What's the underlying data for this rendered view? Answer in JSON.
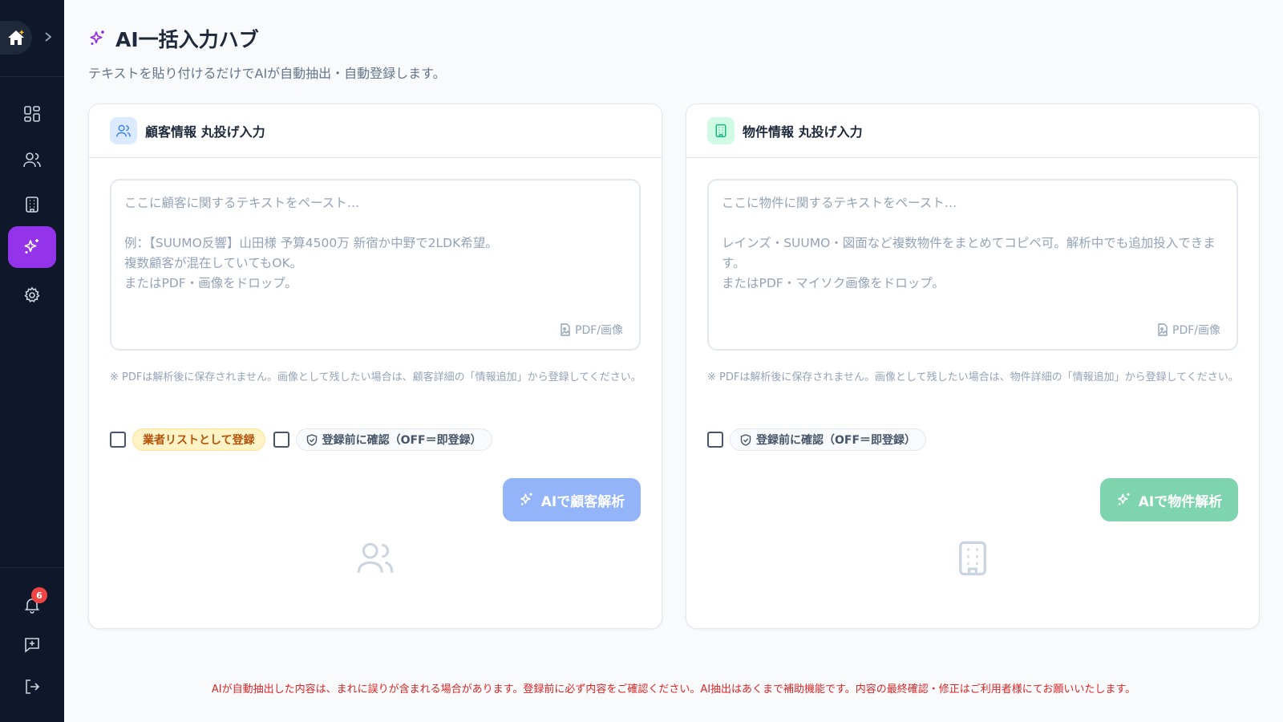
{
  "sidebar": {
    "logo_icon": "home-sparkle-icon",
    "expand_icon": "chevron-right-icon",
    "nav": [
      {
        "icon": "dashboard-icon",
        "label": "dashboard"
      },
      {
        "icon": "users-icon",
        "label": "customers"
      },
      {
        "icon": "building-icon",
        "label": "properties"
      },
      {
        "icon": "sparkles-icon",
        "label": "ai-hub",
        "active": true
      },
      {
        "icon": "gear-icon",
        "label": "settings"
      }
    ],
    "notifications_count": "6",
    "accent_color": "#9333ea"
  },
  "header": {
    "title": "AI一括入力ハブ",
    "subtitle": "テキストを貼り付けるだけでAIが自動抽出・自動登録します。"
  },
  "customer_card": {
    "title": "顧客情報 丸投げ入力",
    "placeholder": "ここに顧客に関するテキストをペースト…\n\n例：【SUUMO反響】山田様 予算4500万 新宿か中野で2LDK希望。\n複数顧客が混在していてもOK。\nまたはPDF・画像をドロップ。",
    "pdf_label": "PDF/画像",
    "note": "※ PDFは解析後に保存されません。画像として残したい場合は、顧客詳細の「情報追加」から登録してください。",
    "vendor_option": "業者リストとして登録",
    "confirm_option": "登録前に確認（OFF＝即登録）",
    "button_label": "AIで顧客解析",
    "button_color": "#93b4f8"
  },
  "property_card": {
    "title": "物件情報 丸投げ入力",
    "placeholder": "ここに物件に関するテキストをペースト…\n\nレインズ・SUUMO・図面など複数物件をまとめてコピペ可。解析中でも追加投入できます。\nまたはPDF・マイソク画像をドロップ。",
    "pdf_label": "PDF/画像",
    "note": "※ PDFは解析後に保存されません。画像として残したい場合は、物件詳細の「情報追加」から登録してください。",
    "confirm_option": "登録前に確認（OFF＝即登録）",
    "button_label": "AIで物件解析",
    "button_color": "#7fd4b0"
  },
  "footer": {
    "disclaimer": "AIが自動抽出した内容は、まれに誤りが含まれる場合があります。登録前に必ず内容をご確認ください。AI抽出はあくまで補助機能です。内容の最終確認・修正はご利用者様にてお願いいたします。"
  }
}
